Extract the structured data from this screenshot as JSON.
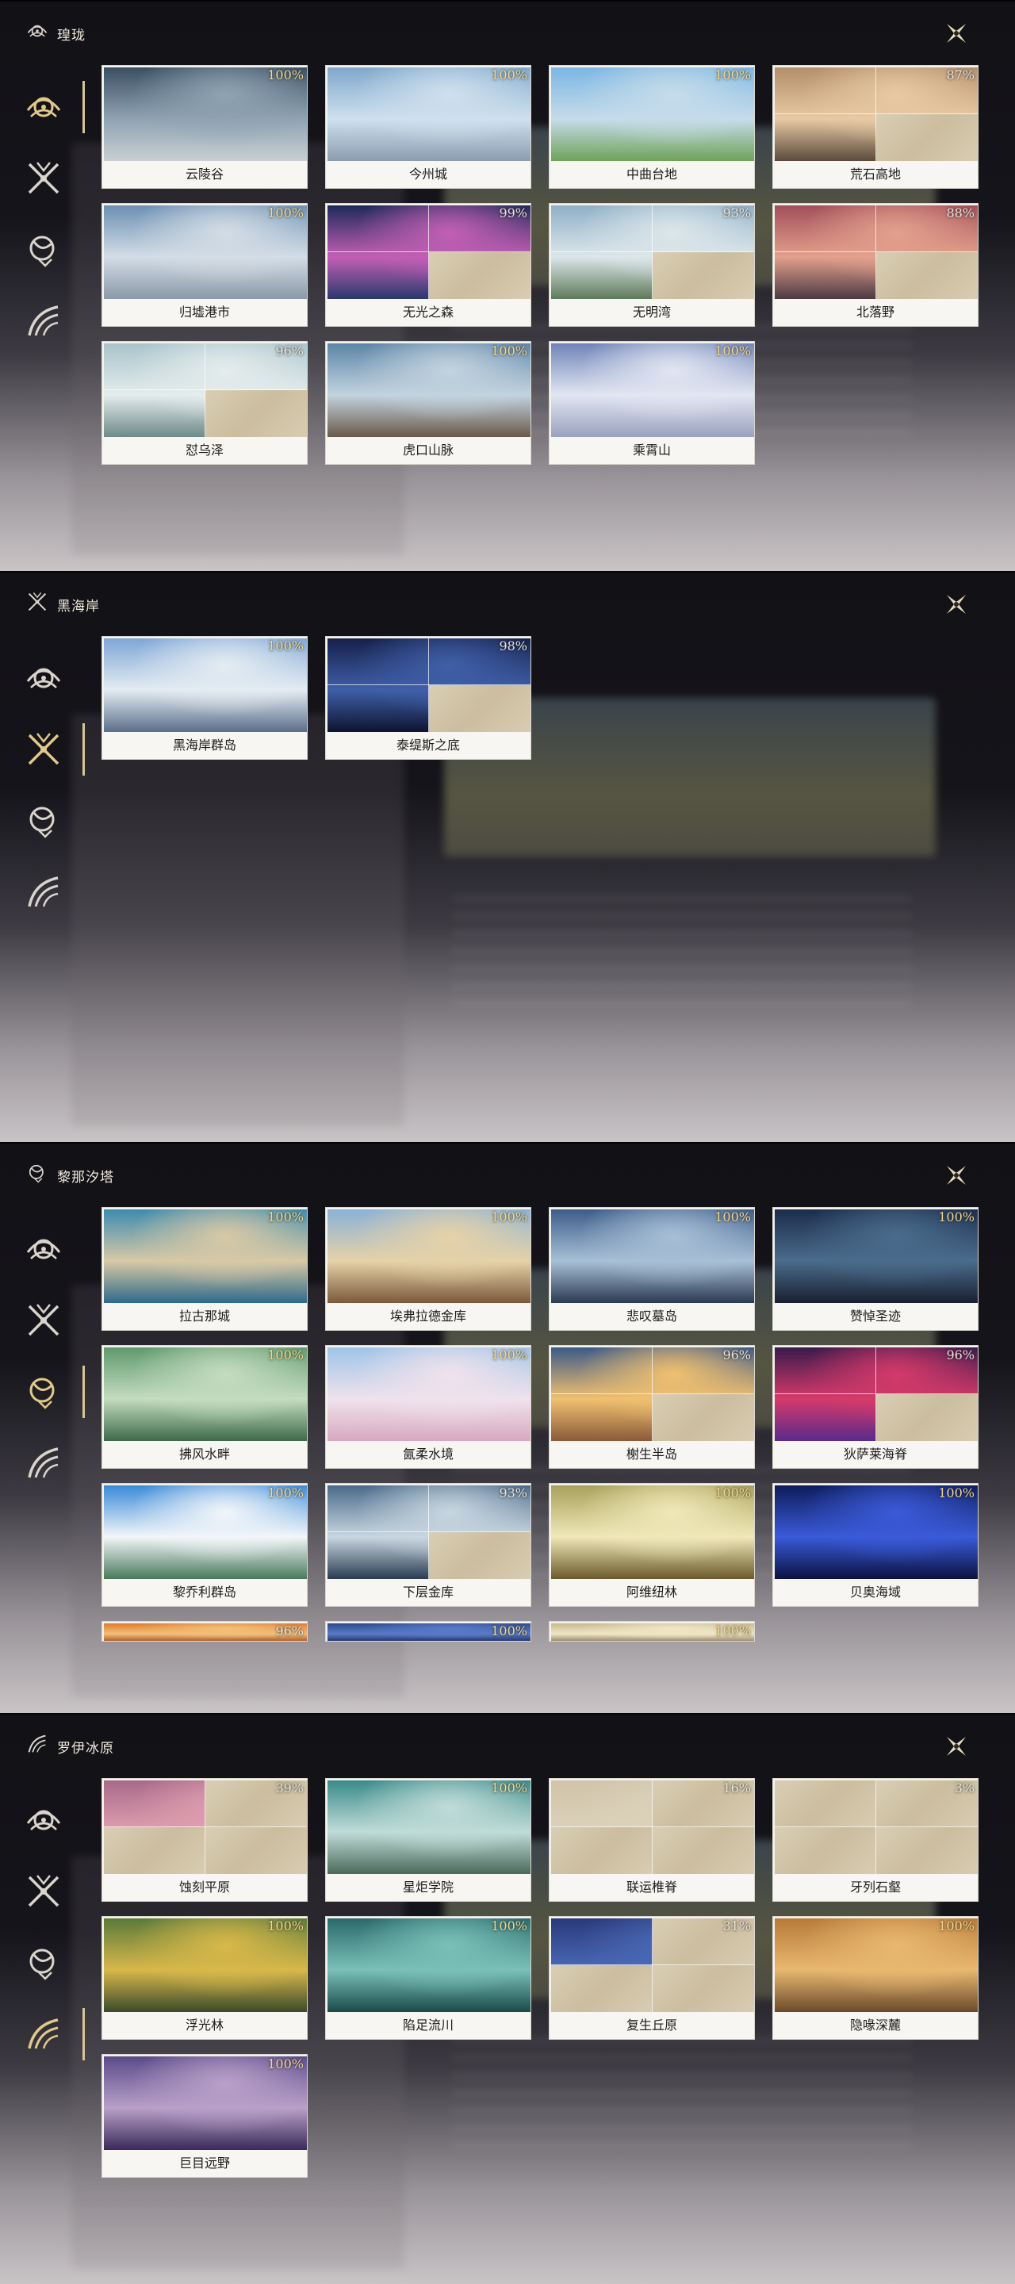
{
  "nav_icons": [
    "lotus-emblem-icon",
    "crossed-swords-icon",
    "maiden-emblem-icon",
    "bird-wing-icon"
  ],
  "colors": {
    "accent_gold": "#d7c59a",
    "percent_gold": "#f2d98f",
    "card_bg": "#f4f3ee"
  },
  "panels": [
    {
      "title": "瑝珑",
      "active_nav": 0,
      "regions": [
        {
          "name": "云陵谷",
          "percent": "100%",
          "completion": 100,
          "art": [
            "#3b4f63",
            "#8fa3b3",
            "#c9cfd2"
          ]
        },
        {
          "name": "今州城",
          "percent": "100%",
          "completion": 100,
          "art": [
            "#7fa8cc",
            "#cfe0ee",
            "#8a9db0"
          ]
        },
        {
          "name": "中曲台地",
          "percent": "100%",
          "completion": 100,
          "art": [
            "#7bb6e3",
            "#c6dcea",
            "#6fa258"
          ]
        },
        {
          "name": "荒石高地",
          "percent": "87%",
          "completion": 87,
          "art": [
            "#b38e6b",
            "#e8c9a4",
            "#5a4a3c"
          ]
        },
        {
          "name": "归墟港市",
          "percent": "100%",
          "completion": 100,
          "art": [
            "#6b8fb3",
            "#d4dde6",
            "#8a99a8"
          ]
        },
        {
          "name": "无光之森",
          "percent": "99%",
          "completion": 99,
          "art": [
            "#1d2a5a",
            "#c25fb4",
            "#2a3a6e"
          ]
        },
        {
          "name": "无明湾",
          "percent": "93%",
          "completion": 93,
          "art": [
            "#8fb0c8",
            "#dce6ea",
            "#5e7a5a"
          ]
        },
        {
          "name": "北落野",
          "percent": "88%",
          "completion": 88,
          "art": [
            "#a14e5a",
            "#e3a08c",
            "#4c3a44"
          ]
        },
        {
          "name": "怼乌泽",
          "percent": "96%",
          "completion": 96,
          "art": [
            "#a9c4cc",
            "#e4ecec",
            "#6f8a8a"
          ]
        },
        {
          "name": "虎口山脉",
          "percent": "100%",
          "completion": 100,
          "art": [
            "#5b85a8",
            "#c3d3df",
            "#6a5a4a"
          ]
        },
        {
          "name": "乘霄山",
          "percent": "100%",
          "completion": 100,
          "art": [
            "#6f84b8",
            "#e2e6f2",
            "#9aa2c0"
          ]
        }
      ]
    },
    {
      "title": "黑海岸",
      "active_nav": 1,
      "regions": [
        {
          "name": "黑海岸群岛",
          "percent": "100%",
          "completion": 100,
          "art": [
            "#7fa6d6",
            "#e4ecf2",
            "#5a6e8a"
          ]
        },
        {
          "name": "泰缇斯之底",
          "percent": "98%",
          "completion": 98,
          "art": [
            "#16204a",
            "#3f5fa8",
            "#0e1430"
          ]
        }
      ]
    },
    {
      "title": "黎那汐塔",
      "active_nav": 2,
      "regions": [
        {
          "name": "拉古那城",
          "percent": "100%",
          "completion": 100,
          "art": [
            "#3d8bb0",
            "#d8c9a6",
            "#2f6a8a"
          ]
        },
        {
          "name": "埃弗拉德金库",
          "percent": "100%",
          "completion": 100,
          "art": [
            "#8ab2d8",
            "#e6d2a8",
            "#7a5a3c"
          ]
        },
        {
          "name": "悲叹墓岛",
          "percent": "100%",
          "completion": 100,
          "art": [
            "#3d5c8a",
            "#a8c0d6",
            "#2a3a52"
          ]
        },
        {
          "name": "赞悼圣迹",
          "percent": "100%",
          "completion": 100,
          "art": [
            "#1c2c4c",
            "#4a6c8c",
            "#1a2030"
          ]
        },
        {
          "name": "拂风水畔",
          "percent": "100%",
          "completion": 100,
          "art": [
            "#5f9a6c",
            "#c4dcc0",
            "#3c6a4a"
          ]
        },
        {
          "name": "氤柔水境",
          "percent": "100%",
          "completion": 100,
          "art": [
            "#9ec4e8",
            "#f0e2ec",
            "#d8a8c0"
          ]
        },
        {
          "name": "榭生半岛",
          "percent": "96%",
          "completion": 96,
          "art": [
            "#3c5a8a",
            "#f0c070",
            "#8a5a3a"
          ]
        },
        {
          "name": "狄萨莱海脊",
          "percent": "96%",
          "completion": 96,
          "art": [
            "#3a1a4c",
            "#d43a6a",
            "#5a2a8a"
          ]
        },
        {
          "name": "黎乔利群岛",
          "percent": "100%",
          "completion": 100,
          "art": [
            "#3a8ad8",
            "#f2f6fa",
            "#4a7a5a"
          ]
        },
        {
          "name": "下层金库",
          "percent": "93%",
          "completion": 93,
          "art": [
            "#4a6a8a",
            "#c8d6e0",
            "#2a3c52"
          ]
        },
        {
          "name": "阿维纽林",
          "percent": "100%",
          "completion": 100,
          "art": [
            "#a8a05a",
            "#f0e8b8",
            "#6a5a2a"
          ]
        },
        {
          "name": "贝奥海域",
          "percent": "100%",
          "completion": 100,
          "art": [
            "#0e1c5a",
            "#3a5ad8",
            "#0a1240"
          ]
        },
        {
          "name": "",
          "percent": "96%",
          "completion": 96,
          "art": [
            "#e07a2a",
            "#f2c07a",
            "#a04a1a"
          ]
        },
        {
          "name": "",
          "percent": "100%",
          "completion": 100,
          "art": [
            "#2a4a8a",
            "#5a7ac8",
            "#1a2a5a"
          ]
        },
        {
          "name": "",
          "percent": "100%",
          "completion": 100,
          "art": [
            "#c8b88a",
            "#f0e6c8",
            "#8a7a5a"
          ]
        }
      ]
    },
    {
      "title": "罗伊冰原",
      "active_nav": 3,
      "regions": [
        {
          "name": "蚀刻平原",
          "percent": "39%",
          "completion": 39,
          "art": [
            "#a86a8a",
            "#e0a0b0",
            "#5a4a6a"
          ]
        },
        {
          "name": "星炬学院",
          "percent": "100%",
          "completion": 100,
          "art": [
            "#3a8a8a",
            "#c0dcd8",
            "#4a6a5a"
          ]
        },
        {
          "name": "联运椎脊",
          "percent": "16%",
          "completion": 16,
          "art": [
            "#d0c4aa",
            "#dcd2ba",
            "#c6b898"
          ]
        },
        {
          "name": "牙列石壑",
          "percent": "3%",
          "completion": 3,
          "art": [
            "#d0c4aa",
            "#dcd2ba",
            "#c6b898"
          ]
        },
        {
          "name": "浮光林",
          "percent": "100%",
          "completion": 100,
          "art": [
            "#5a7a3a",
            "#d8b84a",
            "#3a4a2a"
          ]
        },
        {
          "name": "陷足流川",
          "percent": "100%",
          "completion": 100,
          "art": [
            "#2a6a6a",
            "#7ac0b8",
            "#1a4a4a"
          ]
        },
        {
          "name": "复生丘原",
          "percent": "31%",
          "completion": 31,
          "art": [
            "#2a3a7a",
            "#4a6ab8",
            "#1a2a5a"
          ]
        },
        {
          "name": "隐喙深麓",
          "percent": "100%",
          "completion": 100,
          "art": [
            "#b87a3a",
            "#e8b870",
            "#6a4a2a"
          ]
        },
        {
          "name": "巨目远野",
          "percent": "100%",
          "completion": 100,
          "art": [
            "#5a4a8a",
            "#b8a0c8",
            "#3a2a5a"
          ]
        }
      ]
    }
  ]
}
